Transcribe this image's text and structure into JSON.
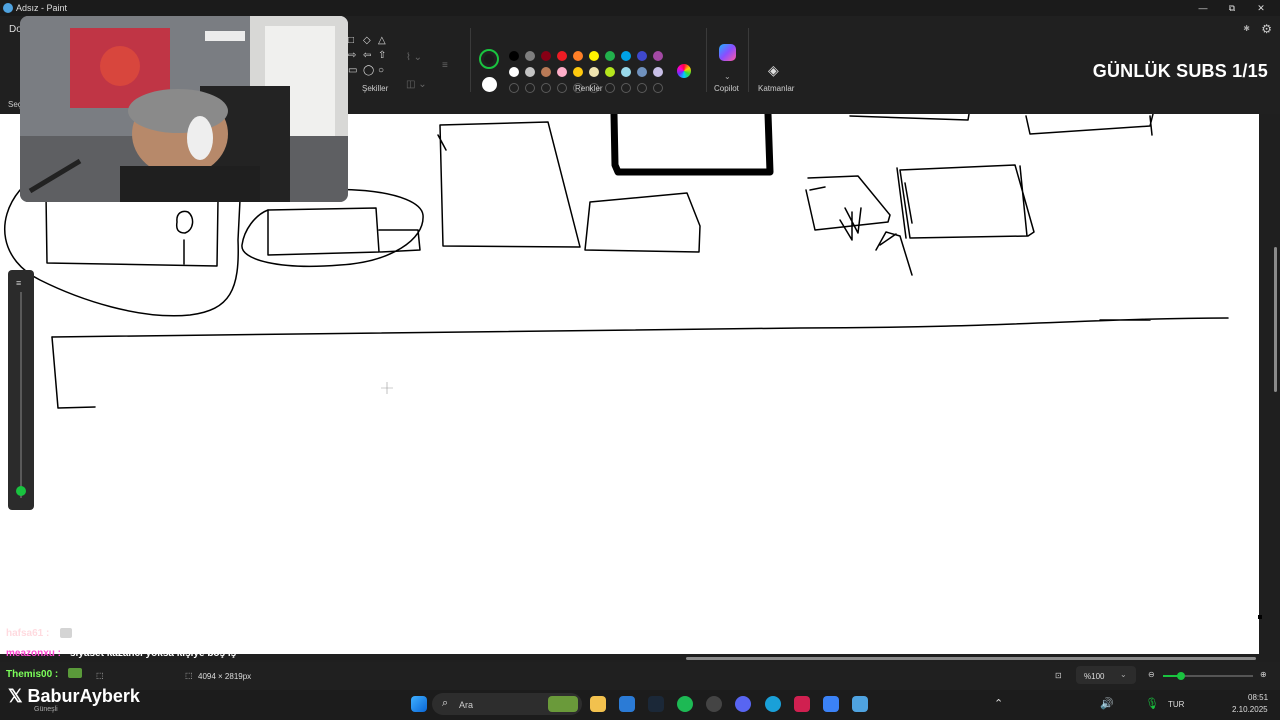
{
  "titlebar": {
    "title": "Adsız - Paint",
    "minimize": "—",
    "restore": "⧉",
    "close": "✕"
  },
  "ribbon": {
    "menu_partial": "Do",
    "selection_partial": "Seç",
    "shapes_label": "Şekiller",
    "colors_label": "Renkler",
    "copilot_label": "Copilot",
    "layers_label": "Katmanlar",
    "primary_color": "#1a1a1a",
    "secondary_color": "#ffffff",
    "palette_row1": [
      "#000000",
      "#7f7f7f",
      "#880015",
      "#ed1c24",
      "#ff7f27",
      "#fff200",
      "#22b14c",
      "#00a2e8",
      "#3f48cc",
      "#a349a4"
    ],
    "palette_row2": [
      "#ffffff",
      "#c3c3c3",
      "#b97a57",
      "#ffaec9",
      "#ffc90e",
      "#efe4b0",
      "#b5e61d",
      "#99d9ea",
      "#7092be",
      "#c8bfe7"
    ]
  },
  "overlay": {
    "header_text": "GÜNLÜK SUBS 1/15",
    "logo_text": "BaburAyberk"
  },
  "chat": [
    {
      "user": "hafsa61 :",
      "message": "",
      "color": "#ffb6c1"
    },
    {
      "user": "meazonxu :",
      "message": "siyaset kazancı yoksa kişiye boş iş",
      "color": "#ff4ad3"
    },
    {
      "user": "Themis00 :",
      "message": "",
      "color": "#7cff5a"
    }
  ],
  "statusbar": {
    "canvas_size": "4094 × 2819px",
    "zoom": "%100",
    "partial_text": "Güneşli"
  },
  "taskbar": {
    "search_placeholder": "Ara",
    "language": "TUR",
    "time": "08:51",
    "date": "2.10.2025"
  }
}
